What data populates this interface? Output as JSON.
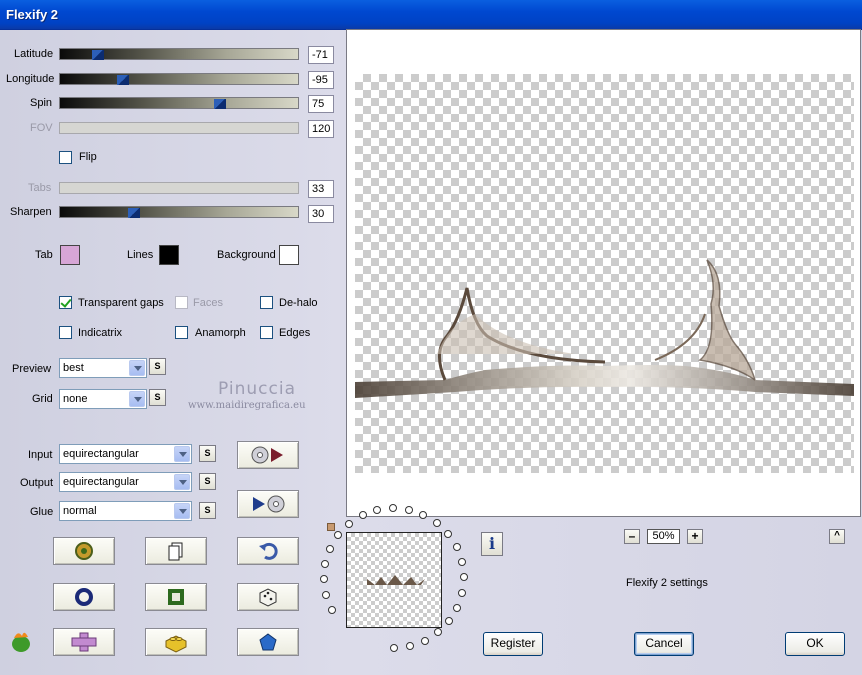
{
  "window": {
    "title": "Flexify 2"
  },
  "sliders": [
    {
      "label": "Latitude",
      "value": "-71",
      "level": 0.14,
      "enabled": true
    },
    {
      "label": "Longitude",
      "value": "-95",
      "level": 0.25,
      "enabled": true
    },
    {
      "label": "Spin",
      "value": "75",
      "level": 0.68,
      "enabled": true
    },
    {
      "label": "FOV",
      "value": "120",
      "enabled": false
    },
    {
      "label": "Tabs",
      "value": "33",
      "enabled": false
    },
    {
      "label": "Sharpen",
      "value": "30",
      "level": 0.3,
      "enabled": true
    }
  ],
  "flip": {
    "label": "Flip",
    "checked": false
  },
  "colors": {
    "tab": {
      "label": "Tab",
      "color": "#d7a6d6"
    },
    "lines": {
      "label": "Lines",
      "color": "#000000"
    },
    "background": {
      "label": "Background",
      "color": "#ffffff"
    }
  },
  "options": {
    "transparent_gaps": {
      "label": "Transparent gaps",
      "checked": true
    },
    "faces": {
      "label": "Faces",
      "checked": false,
      "enabled": false
    },
    "de_halo": {
      "label": "De-halo",
      "checked": false
    },
    "indicatrix": {
      "label": "Indicatrix",
      "checked": false
    },
    "anamorph": {
      "label": "Anamorph",
      "checked": false
    },
    "edges": {
      "label": "Edges",
      "checked": false
    }
  },
  "preview": {
    "label": "Preview",
    "value": "best"
  },
  "grid": {
    "label": "Grid",
    "value": "none"
  },
  "s_button": "S",
  "watermark": {
    "name": "Pinuccia",
    "url": "www.maidiregrafica.eu"
  },
  "input": {
    "label": "Input",
    "value": "equirectangular"
  },
  "output": {
    "label": "Output",
    "value": "equirectangular"
  },
  "glue": {
    "label": "Glue",
    "value": "normal"
  },
  "zoom": {
    "value": "50%",
    "minus": "–",
    "plus": "+"
  },
  "settings_name": "Flexify 2 settings",
  "buttons": {
    "register": "Register",
    "cancel": "Cancel",
    "ok": "OK"
  },
  "icons": {
    "tool_buttons": [
      "randomize-plugin-icon",
      "copy-icon",
      "undo-icon",
      "ring-icon",
      "square-icon",
      "dice-icon",
      "plus-shape-icon",
      "lego-brick-icon",
      "pentagon-icon"
    ],
    "dvd_play_icon": "dvd-play-icon",
    "play_dvd_icon": "play-dvd-icon",
    "info_icon": "info-icon",
    "app_logo_icon": "flaming-pear-icon"
  }
}
